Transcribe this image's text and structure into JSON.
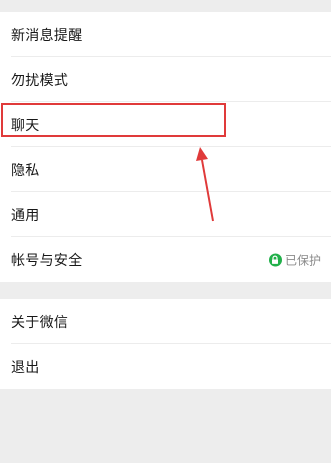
{
  "settings": {
    "group1": [
      {
        "label": "新消息提醒"
      },
      {
        "label": "勿扰模式"
      },
      {
        "label": "聊天"
      },
      {
        "label": "隐私"
      },
      {
        "label": "通用"
      },
      {
        "label": "帐号与安全",
        "status": "已保护"
      }
    ],
    "group2": [
      {
        "label": "关于微信"
      },
      {
        "label": "退出"
      }
    ]
  },
  "colors": {
    "background": "#ededed",
    "cell": "#ffffff",
    "highlight": "#e03a3a",
    "lock_badge": "#21b04a",
    "status_text": "#8a8a8a"
  }
}
